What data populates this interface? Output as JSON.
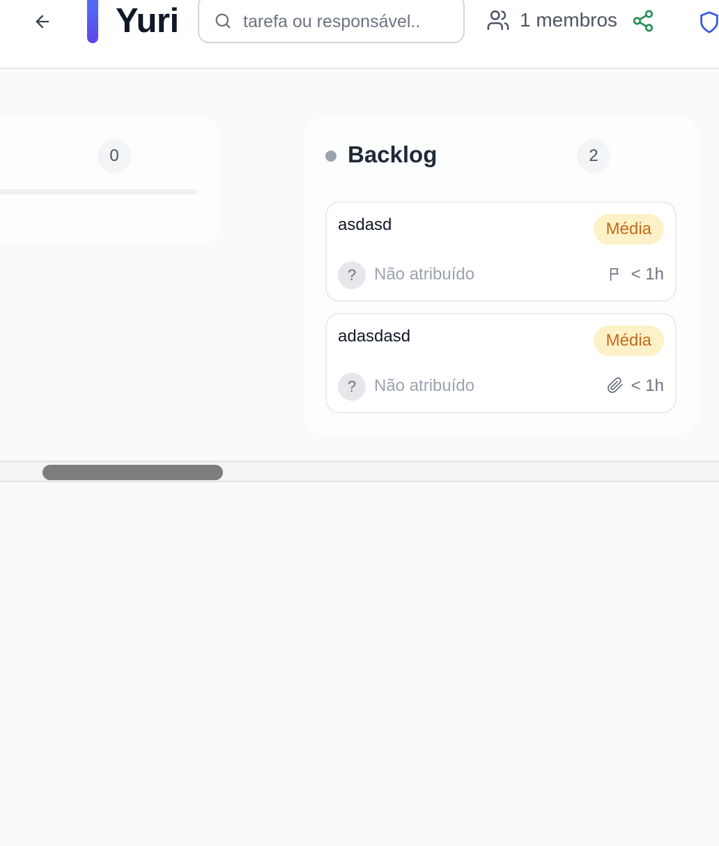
{
  "header": {
    "title": "Yuri",
    "accent_color": "#5a5bf0",
    "search_placeholder": "tarefa ou responsável..",
    "members_label": "1 membros",
    "icons": [
      "arrow-left-icon",
      "search-icon",
      "users-icon",
      "share-icon",
      "shield-icon"
    ]
  },
  "columns": [
    {
      "name": "",
      "count": "0",
      "cards": []
    },
    {
      "name": "Backlog",
      "count": "2",
      "dot_color": "#9ca3af",
      "cards": [
        {
          "title": "asdasd",
          "priority": "Média",
          "avatar": "?",
          "assignee": "Não atribuído",
          "icon": "flag-icon",
          "time": "< 1h"
        },
        {
          "title": "adasdasd",
          "priority": "Média",
          "avatar": "?",
          "assignee": "Não atribuído",
          "icon": "paperclip-icon",
          "time": "< 1h"
        }
      ]
    }
  ],
  "colors": {
    "priority_bg": "#fdf1c8",
    "priority_text": "#c56a1a",
    "share_icon": "#2f8f5b",
    "shield_icon": "#3b5bdb"
  }
}
